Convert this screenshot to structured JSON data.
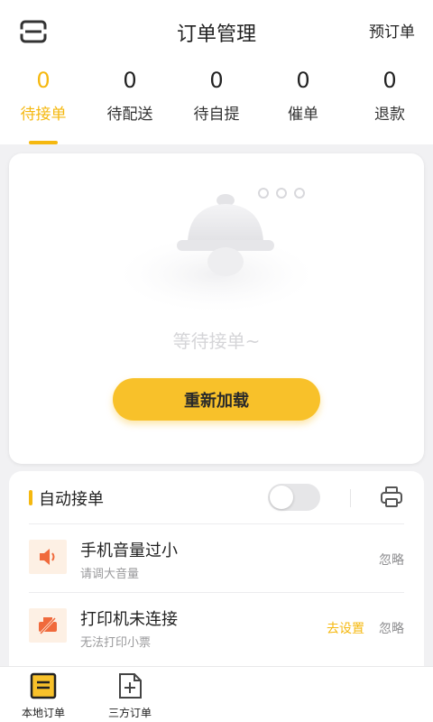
{
  "header": {
    "title": "订单管理",
    "preorder_label": "预订单",
    "menu_icon": "menu-icon"
  },
  "tabs": [
    {
      "count": "0",
      "label": "待接单",
      "active": true
    },
    {
      "count": "0",
      "label": "待配送",
      "active": false
    },
    {
      "count": "0",
      "label": "待自提",
      "active": false
    },
    {
      "count": "0",
      "label": "催单",
      "active": false
    },
    {
      "count": "0",
      "label": "退款",
      "active": false
    }
  ],
  "empty_state": {
    "icon": "bell-icon",
    "message": "等待接单~",
    "reload_label": "重新加载"
  },
  "auto_accept": {
    "label": "自动接单",
    "enabled": false,
    "printer_icon": "printer-icon"
  },
  "alerts": [
    {
      "icon": "speaker-icon",
      "title": "手机音量过小",
      "subtitle": "请调大音量",
      "setup_label": "",
      "ignore_label": "忽略"
    },
    {
      "icon": "printer-off-icon",
      "title": "打印机未连接",
      "subtitle": "无法打印小票",
      "setup_label": "去设置",
      "ignore_label": "忽略"
    }
  ],
  "bottom_nav": [
    {
      "label": "本地订单",
      "icon": "list-icon",
      "active": true
    },
    {
      "label": "三方订单",
      "icon": "add-document-icon",
      "active": false
    }
  ],
  "colors": {
    "accent": "#f5b80f",
    "button": "#f8c12a",
    "alert_icon_bg": "#fdf0e4",
    "alert_icon_fg": "#f06a3c"
  }
}
